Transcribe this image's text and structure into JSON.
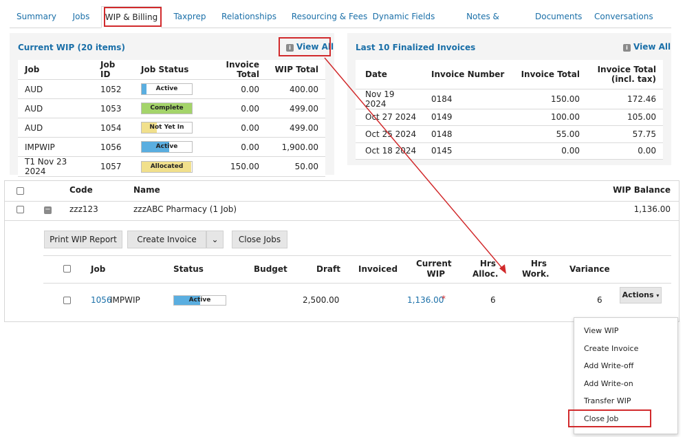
{
  "tabs": [
    "Summary",
    "Jobs",
    "WIP & Billing",
    "Taxprep",
    "Relationships",
    "Resourcing & Fees",
    "Dynamic Fields",
    "Notes & Reminders",
    "Documents",
    "Conversations"
  ],
  "wip": {
    "title": "Current WIP (20 items)",
    "view_all": "View All",
    "info_icon": "i",
    "columns": [
      "Job",
      "Job ID",
      "Job Status",
      "Invoice Total",
      "WIP Total"
    ],
    "rows": [
      {
        "job": "AUD",
        "id": "1052",
        "status": "Active",
        "fill": 0.1,
        "color": "#5aaee0",
        "invoice": "0.00",
        "wip": "400.00"
      },
      {
        "job": "AUD",
        "id": "1053",
        "status": "Complete",
        "fill": 1.0,
        "color": "#a4d46a",
        "invoice": "0.00",
        "wip": "499.00"
      },
      {
        "job": "AUD",
        "id": "1054",
        "status": "Not Yet In",
        "fill": 0.3,
        "color": "#f1e08c",
        "invoice": "0.00",
        "wip": "499.00"
      },
      {
        "job": "IMPWIP",
        "id": "1056",
        "status": "Active",
        "fill": 0.55,
        "color": "#5aaee0",
        "invoice": "0.00",
        "wip": "1,900.00"
      },
      {
        "job": "T1 Nov 23 2024",
        "id": "1057",
        "status": "Allocated",
        "fill": 0.98,
        "color": "#f1e08c",
        "invoice": "150.00",
        "wip": "50.00"
      }
    ]
  },
  "invoices": {
    "title": "Last 10 Finalized Invoices",
    "view_all": "View All",
    "info_icon": "i",
    "columns": [
      "Date",
      "Invoice Number",
      "Invoice Total",
      "Invoice Total",
      "(incl. tax)"
    ],
    "rows": [
      {
        "date": "Nov 19 2024",
        "number": "0184",
        "total": "150.00",
        "incl": "172.46"
      },
      {
        "date": "Oct 27 2024",
        "number": "0149",
        "total": "100.00",
        "incl": "105.00"
      },
      {
        "date": "Oct 25 2024",
        "number": "0148",
        "total": "55.00",
        "incl": "57.75"
      },
      {
        "date": "Oct 18 2024",
        "number": "0145",
        "total": "0.00",
        "incl": "0.00"
      }
    ]
  },
  "client_table": {
    "columns": {
      "code": "Code",
      "name": "Name",
      "balance": "WIP Balance"
    },
    "row": {
      "code": "zzz123",
      "name": "zzzABC Pharmacy (1 Job)",
      "balance": "1,136.00",
      "toggle": "−"
    }
  },
  "toolbar": {
    "print": "Print WIP Report",
    "create_invoice": "Create Invoice",
    "caret": "⌄",
    "close_jobs": "Close Jobs"
  },
  "jobs_table": {
    "columns": {
      "job": "Job",
      "status": "Status",
      "budget": "Budget",
      "draft": "Draft",
      "invoiced": "Invoiced",
      "current": "Current",
      "wip": "WIP",
      "hrs1": "Hrs",
      "alloc": "Alloc.",
      "hrs2": "Hrs",
      "work": "Work.",
      "variance": "Variance"
    },
    "row": {
      "id": "1056",
      "name": "IMPWIP",
      "status": "Active",
      "fill": 0.5,
      "draft": "2,500.00",
      "current": "1,136.00",
      "asterisk": "*",
      "alloc": "6",
      "variance": "6",
      "actions": "Actions",
      "actions_caret": "▾"
    }
  },
  "actions_menu": [
    "View WIP",
    "Create Invoice",
    "Add Write-off",
    "Add Write-on",
    "Transfer WIP",
    "Close Job"
  ],
  "colors": {
    "link": "#1a6fa8",
    "highlight": "#d1292b",
    "active": "#5aaee0",
    "complete": "#a4d46a",
    "pending": "#f1e08c"
  }
}
